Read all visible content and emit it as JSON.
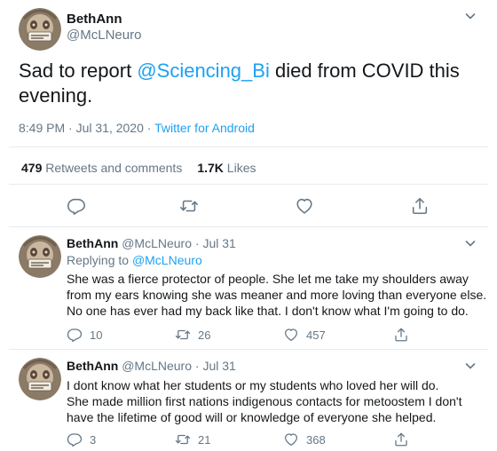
{
  "main_tweet": {
    "author_name": "BethAnn",
    "author_handle": "@McLNeuro",
    "text_before": "Sad to report ",
    "mention": "@Sciencing_Bi",
    "text_after": " died from COVID this evening.",
    "time": "8:49 PM · Jul 31, 2020 · ",
    "source_app": "Twitter for Android",
    "retweets_count": "479",
    "retweets_label": "Retweets and comments",
    "likes_count": "1.7K",
    "likes_label": "Likes"
  },
  "replies": [
    {
      "author_name": "BethAnn",
      "author_handle": "@McLNeuro · Jul 31",
      "replying_prefix": "Replying to ",
      "replying_to": "@McLNeuro",
      "body": [
        "She was a fierce protector of people. She let me take my shoulders away",
        "from my ears knowing she was meaner and more loving than everyone else.",
        "No one has ever had my back like that. I don't know what I'm going to do."
      ],
      "reply_count": "10",
      "retweet_count": "26",
      "like_count": "457"
    },
    {
      "author_name": "BethAnn",
      "author_handle": "@McLNeuro · Jul 31",
      "body": [
        "I dont know what her students or my students who loved her will do.",
        "She made million first nations indigenous contacts for metoostem I don't",
        "have the lifetime of good will or knowledge of everyone she helped."
      ],
      "reply_count": "3",
      "retweet_count": "21",
      "like_count": "368"
    }
  ],
  "icons": [
    "chevron-down-icon",
    "reply-icon",
    "retweet-icon",
    "like-icon",
    "share-icon"
  ],
  "colors": {
    "accent": "#1da1f2",
    "secondary_text": "#657786",
    "divider": "#e6ecf0"
  }
}
